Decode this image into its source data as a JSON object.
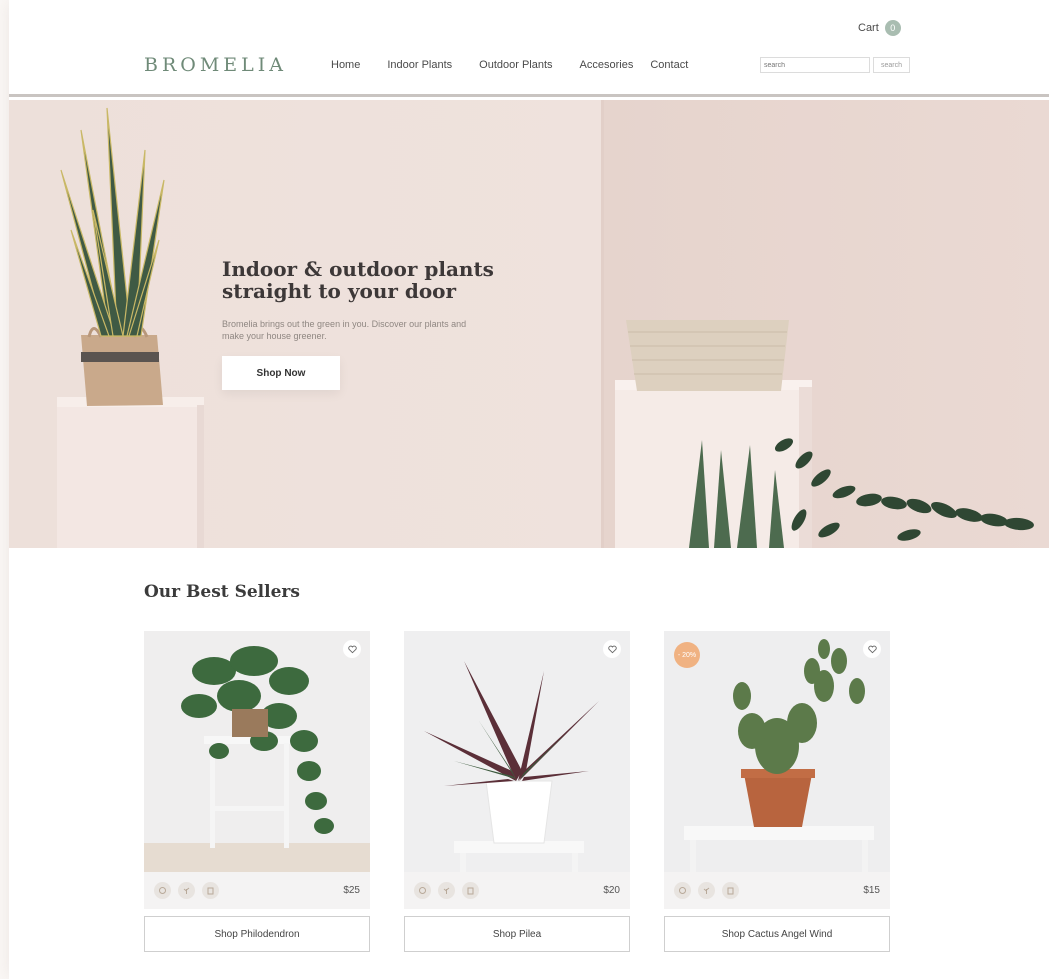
{
  "brand": "BROMELIA",
  "nav": {
    "items": [
      "Home",
      "Indoor Plants",
      "Outdoor Plants",
      "Accesories",
      "Contact"
    ]
  },
  "cart": {
    "label": "Cart",
    "count": "0"
  },
  "search": {
    "placeholder": "search",
    "button_label": "search"
  },
  "hero": {
    "title": "Indoor & outdoor plants straight to your door",
    "subtitle": "Bromelia brings out the green in you. Discover our plants and make your house greener.",
    "cta_label": "Shop Now"
  },
  "best_sellers": {
    "title": "Our Best Sellers",
    "products": [
      {
        "price": "$25",
        "button_label": "Shop Philodendron",
        "sale_badge": ""
      },
      {
        "price": "$20",
        "button_label": "Shop Pilea",
        "sale_badge": ""
      },
      {
        "price": "$15",
        "button_label": "Shop Cactus Angel Wind",
        "sale_badge": "- 20%"
      }
    ]
  },
  "colors": {
    "brand_green": "#6f8a78",
    "hero_bg": "#efe2dd",
    "sale_orange": "#f0b282"
  }
}
